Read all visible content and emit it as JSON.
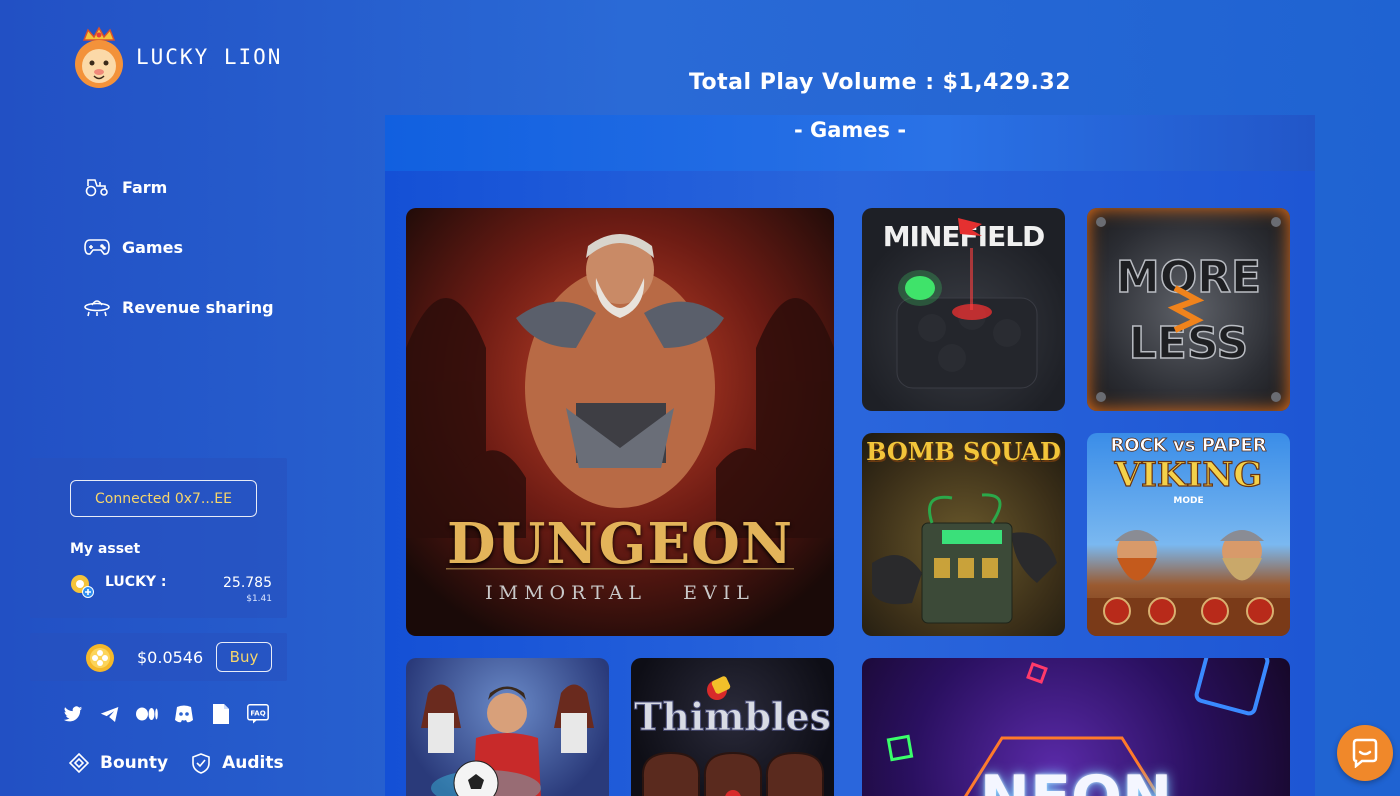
{
  "brand": {
    "name": "LUCKY LION"
  },
  "nav": {
    "items": [
      {
        "label": "Farm",
        "icon": "tractor-icon"
      },
      {
        "label": "Games",
        "icon": "gamepad-icon"
      },
      {
        "label": "Revenue sharing",
        "icon": "ufo-icon"
      }
    ]
  },
  "wallet": {
    "connected_label": "Connected 0x7...EE",
    "my_asset_label": "My asset",
    "token": {
      "name": "LUCKY :",
      "amount": "25.785",
      "usd": "$1.41"
    }
  },
  "price": {
    "value": "$0.0546",
    "buy_label": "Buy"
  },
  "socials": [
    "twitter-icon",
    "telegram-icon",
    "medium-icon",
    "discord-icon",
    "docs-icon",
    "faq-icon"
  ],
  "faq_text": "FAQ",
  "bottom_links": {
    "bounty": "Bounty",
    "audits": "Audits"
  },
  "main": {
    "total_play_volume": "Total Play Volume : $1,429.32",
    "games_title": "- Games -",
    "games": {
      "dungeon": {
        "title": "DUNGEON",
        "subtitle": "IMMORTAL   EVIL"
      },
      "minefield": {
        "title": "MINEFIELD"
      },
      "moreless": {
        "line1": "MORE",
        "line2": "LESS"
      },
      "bombsquad": {
        "title": "BOMB SQUAD"
      },
      "viking": {
        "line1": "ROCK vs PAPER",
        "line2": "VIKING",
        "line3": "MODE"
      },
      "thimbles": {
        "title": "Thimbles"
      },
      "neon": {
        "title": "NEON"
      }
    }
  },
  "colors": {
    "accent_yellow": "#f7d66b",
    "chat_orange": "#f0882a",
    "background_blue": "#2a6ad6"
  }
}
